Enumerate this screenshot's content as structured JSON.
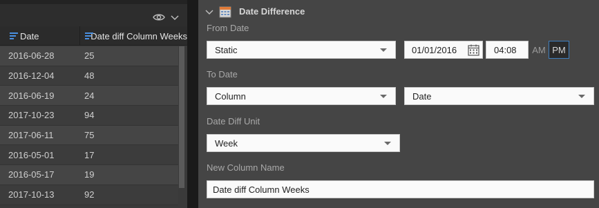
{
  "grid": {
    "columns": [
      "Date",
      "Date diff Column Weeks"
    ],
    "rows": [
      [
        "2016-06-28",
        "25"
      ],
      [
        "2016-12-04",
        "48"
      ],
      [
        "2016-06-19",
        "24"
      ],
      [
        "2017-10-23",
        "94"
      ],
      [
        "2017-06-11",
        "75"
      ],
      [
        "2016-05-01",
        "17"
      ],
      [
        "2016-05-17",
        "19"
      ],
      [
        "2017-10-13",
        "92"
      ]
    ]
  },
  "panel": {
    "title": "Date Difference",
    "from_date": {
      "label": "From Date",
      "type_value": "Static",
      "date_value": "01/01/2016",
      "time_value": "04:08",
      "am_label": "AM",
      "pm_label": "PM",
      "selected_period": "PM"
    },
    "to_date": {
      "label": "To Date",
      "type_value": "Column",
      "column_value": "Date"
    },
    "unit": {
      "label": "Date Diff Unit",
      "value": "Week"
    },
    "new_column": {
      "label": "New Column Name",
      "value": "Date diff Column Weeks"
    }
  },
  "colors": {
    "accent": "#4a90e2",
    "panel_bg": "#454545",
    "grid_bg": "#3a3a3a"
  },
  "icons": [
    "eye-icon",
    "chevron-down-icon",
    "sort-icon",
    "calendar-icon"
  ]
}
